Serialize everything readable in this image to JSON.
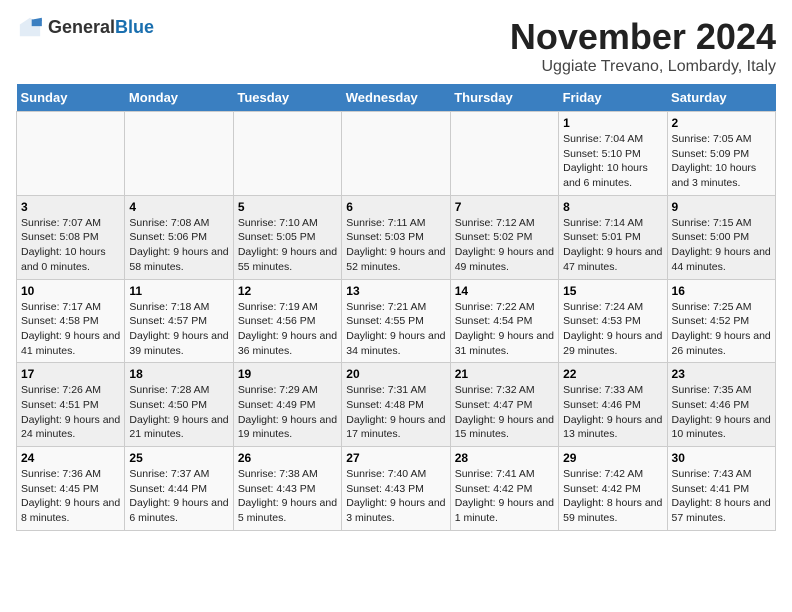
{
  "logo": {
    "text_general": "General",
    "text_blue": "Blue"
  },
  "title": "November 2024",
  "subtitle": "Uggiate Trevano, Lombardy, Italy",
  "weekdays": [
    "Sunday",
    "Monday",
    "Tuesday",
    "Wednesday",
    "Thursday",
    "Friday",
    "Saturday"
  ],
  "weeks": [
    [
      {
        "day": "",
        "info": ""
      },
      {
        "day": "",
        "info": ""
      },
      {
        "day": "",
        "info": ""
      },
      {
        "day": "",
        "info": ""
      },
      {
        "day": "",
        "info": ""
      },
      {
        "day": "1",
        "info": "Sunrise: 7:04 AM\nSunset: 5:10 PM\nDaylight: 10 hours and 6 minutes."
      },
      {
        "day": "2",
        "info": "Sunrise: 7:05 AM\nSunset: 5:09 PM\nDaylight: 10 hours and 3 minutes."
      }
    ],
    [
      {
        "day": "3",
        "info": "Sunrise: 7:07 AM\nSunset: 5:08 PM\nDaylight: 10 hours and 0 minutes."
      },
      {
        "day": "4",
        "info": "Sunrise: 7:08 AM\nSunset: 5:06 PM\nDaylight: 9 hours and 58 minutes."
      },
      {
        "day": "5",
        "info": "Sunrise: 7:10 AM\nSunset: 5:05 PM\nDaylight: 9 hours and 55 minutes."
      },
      {
        "day": "6",
        "info": "Sunrise: 7:11 AM\nSunset: 5:03 PM\nDaylight: 9 hours and 52 minutes."
      },
      {
        "day": "7",
        "info": "Sunrise: 7:12 AM\nSunset: 5:02 PM\nDaylight: 9 hours and 49 minutes."
      },
      {
        "day": "8",
        "info": "Sunrise: 7:14 AM\nSunset: 5:01 PM\nDaylight: 9 hours and 47 minutes."
      },
      {
        "day": "9",
        "info": "Sunrise: 7:15 AM\nSunset: 5:00 PM\nDaylight: 9 hours and 44 minutes."
      }
    ],
    [
      {
        "day": "10",
        "info": "Sunrise: 7:17 AM\nSunset: 4:58 PM\nDaylight: 9 hours and 41 minutes."
      },
      {
        "day": "11",
        "info": "Sunrise: 7:18 AM\nSunset: 4:57 PM\nDaylight: 9 hours and 39 minutes."
      },
      {
        "day": "12",
        "info": "Sunrise: 7:19 AM\nSunset: 4:56 PM\nDaylight: 9 hours and 36 minutes."
      },
      {
        "day": "13",
        "info": "Sunrise: 7:21 AM\nSunset: 4:55 PM\nDaylight: 9 hours and 34 minutes."
      },
      {
        "day": "14",
        "info": "Sunrise: 7:22 AM\nSunset: 4:54 PM\nDaylight: 9 hours and 31 minutes."
      },
      {
        "day": "15",
        "info": "Sunrise: 7:24 AM\nSunset: 4:53 PM\nDaylight: 9 hours and 29 minutes."
      },
      {
        "day": "16",
        "info": "Sunrise: 7:25 AM\nSunset: 4:52 PM\nDaylight: 9 hours and 26 minutes."
      }
    ],
    [
      {
        "day": "17",
        "info": "Sunrise: 7:26 AM\nSunset: 4:51 PM\nDaylight: 9 hours and 24 minutes."
      },
      {
        "day": "18",
        "info": "Sunrise: 7:28 AM\nSunset: 4:50 PM\nDaylight: 9 hours and 21 minutes."
      },
      {
        "day": "19",
        "info": "Sunrise: 7:29 AM\nSunset: 4:49 PM\nDaylight: 9 hours and 19 minutes."
      },
      {
        "day": "20",
        "info": "Sunrise: 7:31 AM\nSunset: 4:48 PM\nDaylight: 9 hours and 17 minutes."
      },
      {
        "day": "21",
        "info": "Sunrise: 7:32 AM\nSunset: 4:47 PM\nDaylight: 9 hours and 15 minutes."
      },
      {
        "day": "22",
        "info": "Sunrise: 7:33 AM\nSunset: 4:46 PM\nDaylight: 9 hours and 13 minutes."
      },
      {
        "day": "23",
        "info": "Sunrise: 7:35 AM\nSunset: 4:46 PM\nDaylight: 9 hours and 10 minutes."
      }
    ],
    [
      {
        "day": "24",
        "info": "Sunrise: 7:36 AM\nSunset: 4:45 PM\nDaylight: 9 hours and 8 minutes."
      },
      {
        "day": "25",
        "info": "Sunrise: 7:37 AM\nSunset: 4:44 PM\nDaylight: 9 hours and 6 minutes."
      },
      {
        "day": "26",
        "info": "Sunrise: 7:38 AM\nSunset: 4:43 PM\nDaylight: 9 hours and 5 minutes."
      },
      {
        "day": "27",
        "info": "Sunrise: 7:40 AM\nSunset: 4:43 PM\nDaylight: 9 hours and 3 minutes."
      },
      {
        "day": "28",
        "info": "Sunrise: 7:41 AM\nSunset: 4:42 PM\nDaylight: 9 hours and 1 minute."
      },
      {
        "day": "29",
        "info": "Sunrise: 7:42 AM\nSunset: 4:42 PM\nDaylight: 8 hours and 59 minutes."
      },
      {
        "day": "30",
        "info": "Sunrise: 7:43 AM\nSunset: 4:41 PM\nDaylight: 8 hours and 57 minutes."
      }
    ]
  ]
}
